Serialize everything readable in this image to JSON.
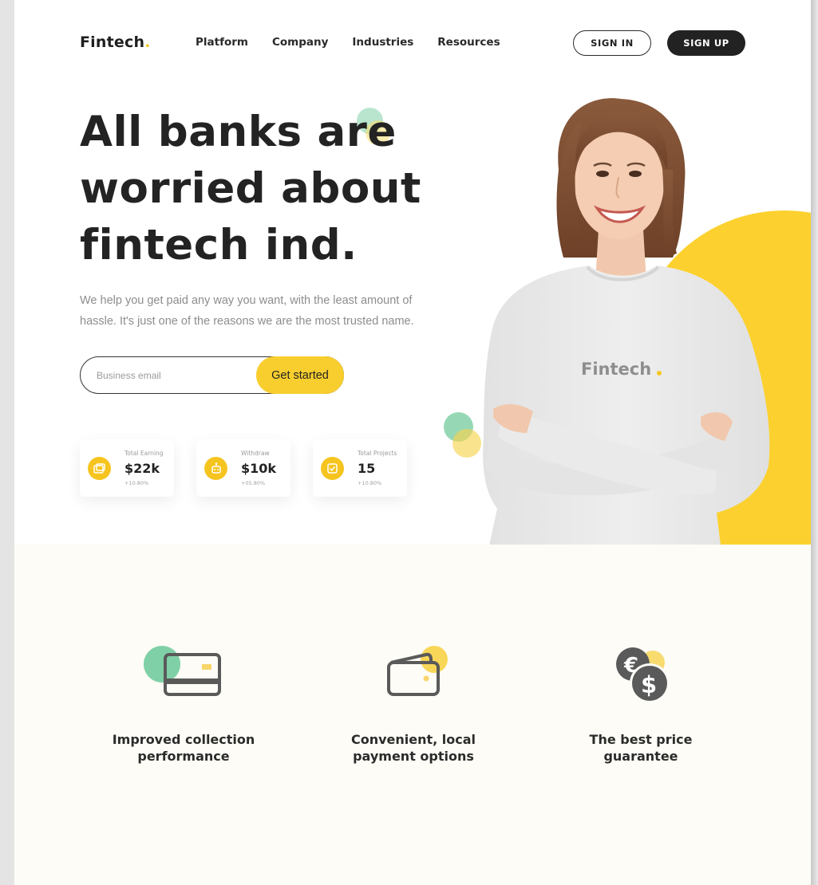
{
  "brand": {
    "name": "Fintech",
    "dot": ".",
    "accent": "#f8ce2e",
    "green": "#7fd0a6"
  },
  "nav": {
    "links": [
      "Platform",
      "Company",
      "Industries",
      "Resources"
    ],
    "sign_in": "SIGN IN",
    "sign_up": "SIGN UP"
  },
  "hero": {
    "title_lines": [
      "All banks are",
      "worried about",
      "fintech ind."
    ],
    "subtitle_lines": [
      "We help you get paid any way you want, with the least amount of",
      "hassle. It's just one of the reasons we are the most trusted name."
    ],
    "email_placeholder": "Business email",
    "cta": "Get started",
    "shirt_logo": "Fintech"
  },
  "stats": [
    {
      "label": "Total Earning",
      "value": "$22k",
      "change": "+10.80%",
      "icon": "wallet-icon"
    },
    {
      "label": "Withdraw",
      "value": "$10k",
      "change": "+05.80%",
      "icon": "robot-icon"
    },
    {
      "label": "Total Projects",
      "value": "15",
      "change": "+10.80%",
      "icon": "checkbox-icon"
    }
  ],
  "features": [
    {
      "title_lines": [
        "Improved collection",
        "performance"
      ],
      "icon": "credit-card-icon"
    },
    {
      "title_lines": [
        "Convenient, local",
        "payment options"
      ],
      "icon": "wallet-icon"
    },
    {
      "title_lines": [
        "The best price",
        "guarantee"
      ],
      "icon": "currency-coins-icon"
    }
  ]
}
